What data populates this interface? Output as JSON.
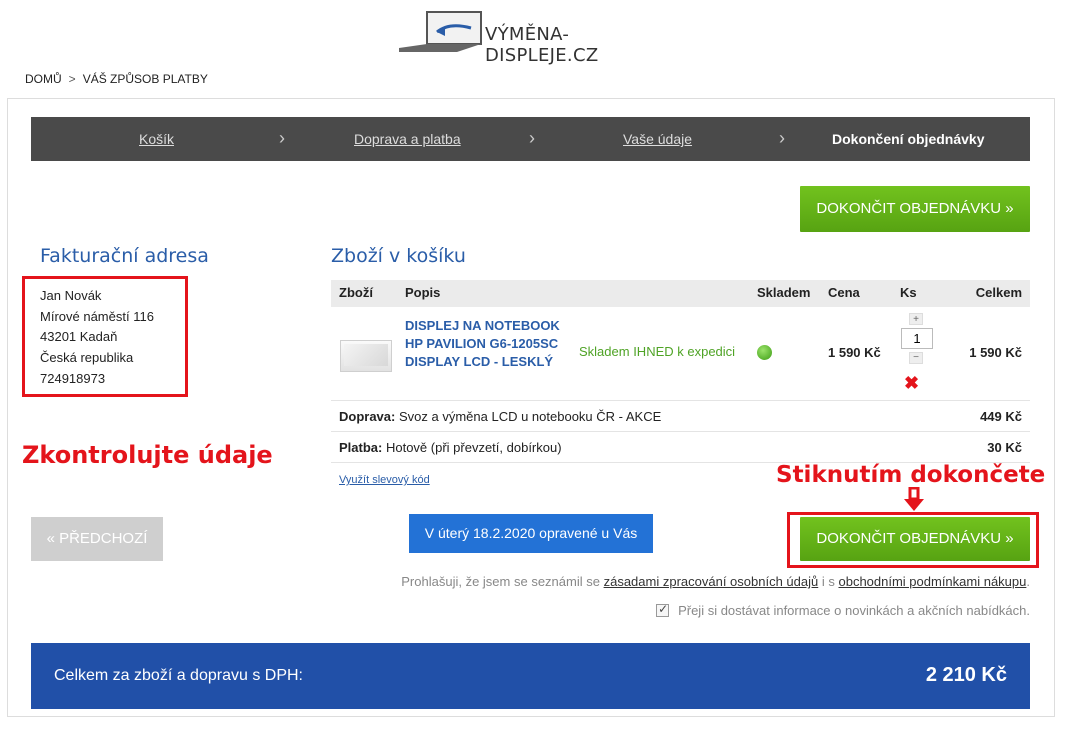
{
  "header": {
    "logo_text": "VÝMĚNA-DISPLEJE.CZ"
  },
  "breadcrumb": {
    "home": "DOMŮ",
    "separator": ">",
    "current": "VÁŠ ZPŮSOB PLATBY"
  },
  "steps": [
    {
      "label": "Košík"
    },
    {
      "label": "Doprava a platba"
    },
    {
      "label": "Vaše údaje"
    },
    {
      "label": "Dokončení objednávky"
    }
  ],
  "step_separator": "›",
  "finish_button_top": "DOKONČIT OBJEDNÁVKU »",
  "finish_button_bottom": "DOKONČIT OBJEDNÁVKU »",
  "billing": {
    "title": "Fakturační adresa",
    "name": "Jan Novák",
    "street": "Mírové náměstí 116",
    "city": "43201 Kadaň",
    "country": "Česká republika",
    "phone": "724918973"
  },
  "annotations": {
    "check_data": "Zkontrolujte údaje",
    "press_finish": "Stiknutím dokončete"
  },
  "cart": {
    "title": "Zboží v košíku",
    "headers": {
      "item": "Zboží",
      "description": "Popis",
      "stock": "Skladem",
      "price": "Cena",
      "qty": "Ks",
      "total": "Celkem"
    },
    "items": [
      {
        "name": "DISPLEJ NA NOTEBOOK HP PAVILION G6-1205SC DISPLAY LCD - LESKLÝ",
        "stock": "Skladem IHNED k expedici",
        "price": "1 590 Kč",
        "qty": "1",
        "qty_plus": "+",
        "qty_minus": "−",
        "remove": "✖",
        "total": "1 590 Kč"
      }
    ],
    "shipping": {
      "label": "Doprava:",
      "value": "Svoz a výměna LCD u notebooku ČR - AKCE",
      "amount": "449 Kč"
    },
    "payment": {
      "label": "Platba:",
      "value": "Hotově (při převzetí, dobírkou)",
      "amount": "30 Kč"
    },
    "coupon_link": "Využít slevový kód"
  },
  "buttons": {
    "previous": "« PŘEDCHOZÍ",
    "delivery_info": "V úterý 18.2.2020 opravené u Vás"
  },
  "consent": {
    "text1": "Prohlašuji, že jsem se seznámil se",
    "link1": "zásadami zpracování osobních údajů",
    "text2": "i s",
    "link2": "obchodními podmínkami nákupu",
    "text3": ".",
    "newsletter": "Přeji si dostávat informace o novinkách a akčních nabídkách.",
    "newsletter_checked": true
  },
  "summary": {
    "label": "Celkem za zboží a dopravu s DPH:",
    "amount": "2 210 Kč"
  },
  "colors": {
    "green": "#5fae16",
    "blue": "#2150a8",
    "link_blue": "#2a5da8",
    "annotation_red": "#e4141b",
    "steps_bar": "#4a4a4a"
  }
}
